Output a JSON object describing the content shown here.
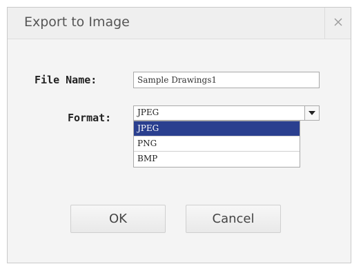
{
  "dialog": {
    "title": "Export to Image",
    "close_icon": "close-icon"
  },
  "form": {
    "file_name_label": "File Name:",
    "file_name_value": "Sample Drawings1",
    "format_label": "Format:",
    "format_value": "JPEG",
    "format_options": [
      "JPEG",
      "PNG",
      "BMP"
    ],
    "highlighted_option": "JPEG"
  },
  "buttons": {
    "ok_label": "OK",
    "cancel_label": "Cancel"
  },
  "colors": {
    "highlight": "#2a3f8f",
    "dialog_bg": "#f4f4f4"
  }
}
